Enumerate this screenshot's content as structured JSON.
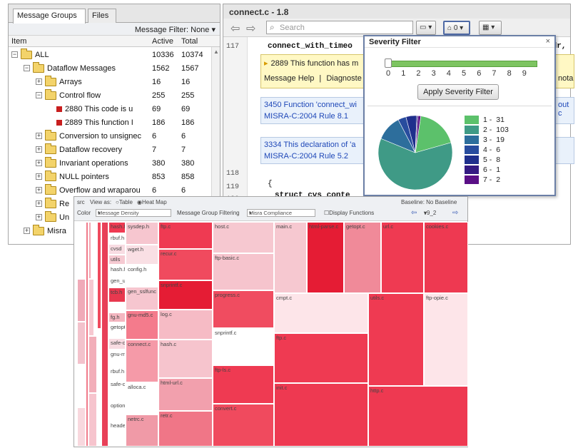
{
  "left_panel": {
    "tabs": [
      "Message Groups",
      "Files"
    ],
    "filter_label": "Message Filter: None ▾",
    "columns": {
      "item": "Item",
      "active": "Active",
      "total": "Total"
    },
    "rows": [
      {
        "label": "ALL",
        "active": "10336",
        "total": "10374",
        "indent": 0,
        "kind": "folder",
        "exp": "−"
      },
      {
        "label": "Dataflow Messages",
        "active": "1562",
        "total": "1567",
        "indent": 1,
        "kind": "folder",
        "exp": "−"
      },
      {
        "label": "Arrays",
        "active": "16",
        "total": "16",
        "indent": 2,
        "kind": "folder",
        "exp": "+"
      },
      {
        "label": "Control flow",
        "active": "255",
        "total": "255",
        "indent": 2,
        "kind": "folder",
        "exp": "−"
      },
      {
        "label": "2880 This code is u",
        "active": "69",
        "total": "69",
        "indent": 3,
        "kind": "msg",
        "exp": ""
      },
      {
        "label": "2889 This function I",
        "active": "186",
        "total": "186",
        "indent": 3,
        "kind": "msg",
        "exp": ""
      },
      {
        "label": "Conversion to unsignec",
        "active": "6",
        "total": "6",
        "indent": 2,
        "kind": "folder",
        "exp": "+"
      },
      {
        "label": "Dataflow recovery",
        "active": "7",
        "total": "7",
        "indent": 2,
        "kind": "folder",
        "exp": "+"
      },
      {
        "label": "Invariant operations",
        "active": "380",
        "total": "380",
        "indent": 2,
        "kind": "folder",
        "exp": "+"
      },
      {
        "label": "NULL pointers",
        "active": "853",
        "total": "858",
        "indent": 2,
        "kind": "folder",
        "exp": "+"
      },
      {
        "label": "Overflow and wraparou",
        "active": "6",
        "total": "6",
        "indent": 2,
        "kind": "folder",
        "exp": "+"
      },
      {
        "label": "Re",
        "active": "",
        "total": "",
        "indent": 2,
        "kind": "folder",
        "exp": "+"
      },
      {
        "label": "Un",
        "active": "",
        "total": "",
        "indent": 2,
        "kind": "folder",
        "exp": "+"
      },
      {
        "label": "Misra",
        "active": "",
        "total": "",
        "indent": 1,
        "kind": "folder",
        "exp": "+"
      }
    ]
  },
  "code_panel": {
    "title": "connect.c - 1.8",
    "search_placeholder": "Search",
    "filter_button": "0",
    "line_numbers": [
      "117",
      "118",
      "119",
      "120"
    ],
    "code_117": "connect_with_timeo",
    "code_117_tail": "ddr,",
    "code_119": "{",
    "code_120": "struct cvs_conte",
    "message_1": {
      "text": "2889 This function has m",
      "help": "Message Help",
      "sep": "|",
      "diag": "Diagnoste",
      "tail": "nota"
    },
    "message_2": {
      "text": "3450 Function 'connect_wi",
      "rule": "MISRA-C:2004 Rule 8.1",
      "tail": "out c"
    },
    "message_3": {
      "text": "3334 This declaration of 'a",
      "rule": "MISRA-C:2004 Rule 5.2"
    }
  },
  "severity_filter": {
    "title": "Severity Filter",
    "close": "×",
    "ticks": [
      "0",
      "1",
      "2",
      "3",
      "4",
      "5",
      "6",
      "7",
      "8",
      "9"
    ],
    "apply_label": "Apply Severity Filter",
    "legend": [
      {
        "label": "1 -",
        "value": 31,
        "color": "#5cc16b"
      },
      {
        "label": "2 -",
        "value": 103,
        "color": "#3f9a86"
      },
      {
        "label": "3 -",
        "value": 19,
        "color": "#2d6e9c"
      },
      {
        "label": "4 -",
        "value": 6,
        "color": "#284c9e"
      },
      {
        "label": "5 -",
        "value": 8,
        "color": "#1f2f8c"
      },
      {
        "label": "6 -",
        "value": 1,
        "color": "#341a82"
      },
      {
        "label": "7 -",
        "value": 2,
        "color": "#5a0f86"
      }
    ]
  },
  "heatmap": {
    "view_as": "View as:",
    "opt_table": "Table",
    "opt_heat": "Heat Map",
    "baseline": "Baseline: No Baseline",
    "color_label": "Color",
    "color_value": "Message Density",
    "group_label": "Message Group Filtering",
    "group_value": "Misra Compliance",
    "display_functions": "Display Functions",
    "version": "v9_2",
    "src_label": "src",
    "cells": [
      {
        "label": "",
        "c": "#ffffff"
      },
      {
        "label": "",
        "c": "#ffffff"
      },
      {
        "label": "",
        "c": "#ffffff"
      },
      {
        "label": "",
        "c": "#ffffff"
      },
      {
        "label": "",
        "c": "#ffffff"
      },
      {
        "label": "",
        "c": "#f0aab8"
      },
      {
        "label": "",
        "c": "#f3c2cc"
      },
      {
        "label": "",
        "c": "#ffffff"
      },
      {
        "label": "",
        "c": "#f8d8de"
      },
      {
        "label": "",
        "c": "#f07a8a"
      },
      {
        "label": "",
        "c": "#f3a8b4"
      },
      {
        "label": "",
        "c": "#ffffff"
      },
      {
        "label": "",
        "c": "#f6c8d0"
      },
      {
        "label": "",
        "c": "#ffffff"
      },
      {
        "label": "",
        "c": "#f2aeb9"
      },
      {
        "label": "",
        "c": "#f6c4cd"
      },
      {
        "label": "",
        "c": "#f04a5e"
      },
      {
        "label": "",
        "c": "#ffffff"
      },
      {
        "label": "",
        "c": "#e84058"
      },
      {
        "label": "hash.h",
        "c": "#ef3a52"
      },
      {
        "label": "rbuf.h",
        "c": "#ffffff"
      },
      {
        "label": "cvsd",
        "c": "#f8dce2"
      },
      {
        "label": "utils",
        "c": "#f6cad2"
      },
      {
        "label": "hash.h",
        "c": "#ffffff"
      },
      {
        "label": "gen_util.h",
        "c": "#ffffff"
      },
      {
        "label": "tcb.h",
        "c": "#e8384f"
      },
      {
        "label": "",
        "c": "#ffffff"
      },
      {
        "label": "fg.h",
        "c": "#f4b6c0"
      },
      {
        "label": "getopt.h",
        "c": "#ffffff"
      },
      {
        "label": "safe-ctype.h",
        "c": "#f8dce2"
      },
      {
        "label": "gnu-mdt.h",
        "c": "#ffffff"
      },
      {
        "label": "rbuf.h",
        "c": "#ffffff"
      },
      {
        "label": "safe-ctype.c",
        "c": "#ffffff"
      },
      {
        "label": "options",
        "c": "#ffffff"
      },
      {
        "label": "header",
        "c": "#ffffff"
      },
      {
        "label": "sysdep.h",
        "c": "#f6c6cf"
      },
      {
        "label": "wget.h",
        "c": "#f9dfe4"
      },
      {
        "label": "config.h",
        "c": "#ffffff"
      },
      {
        "label": "gen_sslfunc",
        "c": "#f6c6cf"
      },
      {
        "label": "gnu-md5.c",
        "c": "#f47b8c"
      },
      {
        "label": "connect.c",
        "c": "#f59aa8"
      },
      {
        "label": "alloca.c",
        "c": "#ffffff"
      },
      {
        "label": "netrc.c",
        "c": "#f09aa7"
      },
      {
        "label": "ftp.c",
        "c": "#ef3a52"
      },
      {
        "label": "recur.c",
        "c": "#f04a5e"
      },
      {
        "label": "snprintf.c",
        "c": "#e51c34"
      },
      {
        "label": "log.c",
        "c": "#f6bbc5"
      },
      {
        "label": "hash.c",
        "c": "#f6c4cd"
      },
      {
        "label": "html-url.c",
        "c": "#f2a0ad"
      },
      {
        "label": "retr.c",
        "c": "#f07687"
      },
      {
        "label": "host.c",
        "c": "#f6c8d0"
      },
      {
        "label": "ftp-basic.c",
        "c": "#f6c4cd"
      },
      {
        "label": "progress.c",
        "c": "#f04c60"
      },
      {
        "label": "snprintf.c",
        "c": "#ffffff"
      },
      {
        "label": "ftp-ls.c",
        "c": "#ef3a52"
      },
      {
        "label": "convert.c",
        "c": "#f04a5e"
      },
      {
        "label": "main.c",
        "c": "#f6c8d0"
      },
      {
        "label": "cmpt.c",
        "c": "#fde5e9"
      },
      {
        "label": "ftp.c",
        "c": "#ef3a52"
      },
      {
        "label": "init.c",
        "c": "#ee3951"
      },
      {
        "label": "html-parse.c",
        "c": "#e51c34"
      },
      {
        "label": "getopt.c",
        "c": "#f08a99"
      },
      {
        "label": "url.c",
        "c": "#ef3a52"
      },
      {
        "label": "cookies.c",
        "c": "#ee3951"
      },
      {
        "label": "utils.c",
        "c": "#ef3a52"
      },
      {
        "label": "ftp-opie.c",
        "c": "#fde5e9"
      },
      {
        "label": "http.c",
        "c": "#ee3951"
      }
    ]
  }
}
